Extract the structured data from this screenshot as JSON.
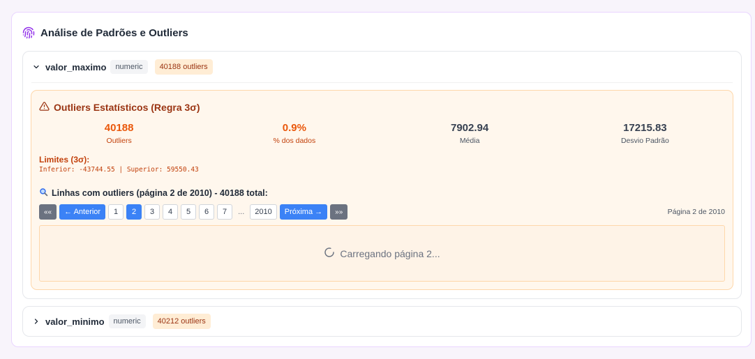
{
  "panel": {
    "title": "Análise de Padrões e Outliers",
    "icon": "fingerprint-icon"
  },
  "sections": [
    {
      "column": "valor_maximo",
      "type": "numeric",
      "outliers_badge": "40188 outliers",
      "expanded": true,
      "outlier_box": {
        "title": "Outliers Estatísticos (Regra 3σ)",
        "stats": [
          {
            "value": "40188",
            "label": "Outliers"
          },
          {
            "value": "0.9%",
            "label": "% dos dados"
          },
          {
            "value": "7902.94",
            "label": "Média"
          },
          {
            "value": "17215.83",
            "label": "Desvio Padrão"
          }
        ],
        "limits_title": "Limites (3σ):",
        "limits_values": "Inferior: -43744.55 | Superior: 59550.43",
        "rows_title": "Linhas com outliers (página 2 de 2010) - 40188 total:",
        "pagination": {
          "first": "««",
          "prev": "← Anterior",
          "pages": [
            "1",
            "2",
            "3",
            "4",
            "5",
            "6",
            "7"
          ],
          "current": "2",
          "ellipsis": "...",
          "last_page": "2010",
          "next": "Próxima →",
          "last": "»»",
          "info": "Página 2 de 2010"
        },
        "loading_text": "Carregando página 2..."
      }
    },
    {
      "column": "valor_minimo",
      "type": "numeric",
      "outliers_badge": "40212 outliers",
      "expanded": false
    }
  ],
  "colors": {
    "accent": "#3b82f6",
    "warning": "#c2410c",
    "panel_border": "#e9d5ff"
  }
}
